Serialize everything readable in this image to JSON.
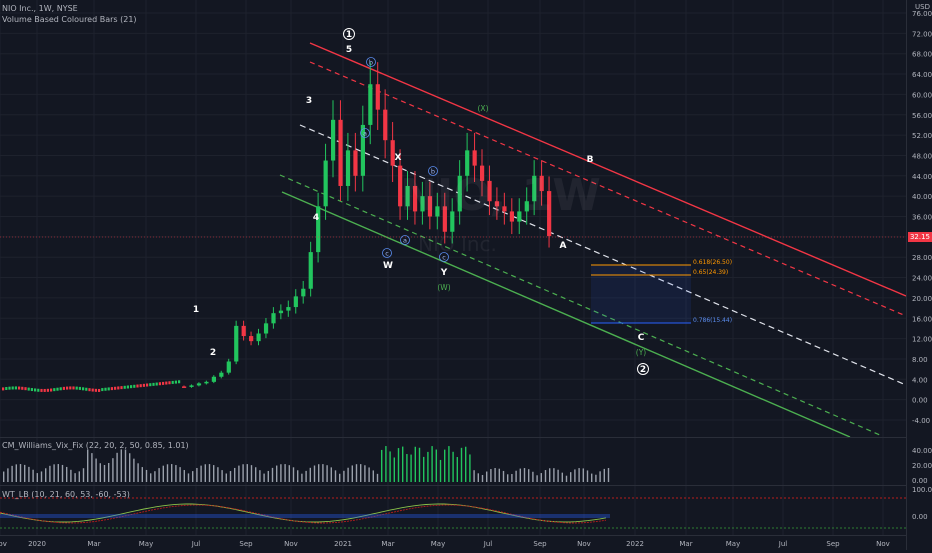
{
  "header": {
    "symbol_title": "NIO Inc., 1W, NYSE",
    "indicator_label": "Volume Based Coloured Bars (21)"
  },
  "indicators": {
    "vix_fix_label": "CM_Williams_Vix_Fix (22, 20, 2, 50, 0.85, 1.01)",
    "wt_lb_label": "WT_LB (10, 21, 60, 53, -60, -53)"
  },
  "watermark": {
    "ticker": "NIO, 1W",
    "name": "NIO Inc."
  },
  "price_axis": {
    "currency": "USD",
    "ticks": [
      "76.00",
      "72.00",
      "68.00",
      "64.00",
      "60.00",
      "56.00",
      "52.00",
      "48.00",
      "44.00",
      "40.00",
      "36.00",
      "32.00",
      "28.00",
      "24.00",
      "20.00",
      "16.00",
      "12.00",
      "8.00",
      "4.00",
      "0.00",
      "-4.00"
    ],
    "current_price": "32.15"
  },
  "volume_axis": {
    "ticks": [
      "40.00",
      "20.00",
      "0.00"
    ]
  },
  "wt_axis": {
    "ticks": [
      "100.00",
      "0.00"
    ]
  },
  "time_axis": {
    "ticks": [
      "Nov",
      "2020",
      "Mar",
      "May",
      "Jul",
      "Sep",
      "Nov",
      "2021",
      "Mar",
      "May",
      "Jul",
      "Sep",
      "Nov",
      "2022",
      "Mar",
      "May",
      "Jul",
      "Sep",
      "Nov"
    ]
  },
  "wave_labels": {
    "primary": [
      "1",
      "2"
    ],
    "intermediate": [
      "1",
      "2",
      "3",
      "4",
      "5",
      "W",
      "X",
      "Y",
      "A",
      "B",
      "C"
    ],
    "minor": [
      "a",
      "b",
      "c",
      "a",
      "b",
      "c"
    ],
    "green": [
      "(X)",
      "(W)",
      "(Y)"
    ]
  },
  "fib_levels": [
    "0.618(26.50)",
    "0.65(24.39)",
    "0.786(15.44)"
  ],
  "colors": {
    "background": "#131722",
    "bull": "#22c55e",
    "bear": "#f23645",
    "channel_red": "#f23645",
    "channel_green": "#4caf50",
    "mid": "#e0e3eb",
    "fib_orange": "#ff9800",
    "fib_blue": "#2962ff"
  },
  "chart_data": {
    "type": "candlestick",
    "weekly_closes": [
      2,
      2,
      2.3,
      2.7,
      3.2,
      3.4,
      3.1,
      2.6,
      2.5,
      2.8,
      3.2,
      3.5,
      4.5,
      5.3,
      7.5,
      14.5,
      12.5,
      11.5,
      13,
      15,
      17,
      17.5,
      18.2,
      20.3,
      21.8,
      29,
      38,
      47,
      55,
      42,
      49,
      44,
      54,
      62,
      57,
      51,
      46,
      38,
      42,
      37,
      40,
      36,
      38,
      33,
      37,
      44,
      49,
      46,
      43,
      39,
      38,
      37,
      35,
      37,
      39,
      44,
      41,
      32.15
    ]
  }
}
